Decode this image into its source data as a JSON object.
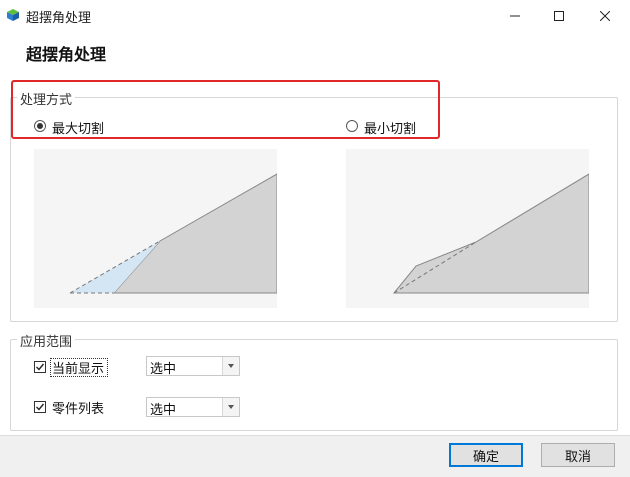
{
  "window": {
    "title": "超摆角处理",
    "icon": "app-cube-icon"
  },
  "header": {
    "title": "超摆角处理"
  },
  "processing_mode": {
    "group_label": "处理方式",
    "options": [
      {
        "label": "最大切割",
        "selected": true
      },
      {
        "label": "最小切割",
        "selected": false
      }
    ]
  },
  "apply_scope": {
    "group_label": "应用范围",
    "rows": [
      {
        "label": "当前显示",
        "checked": true,
        "combo_value": "选中"
      },
      {
        "label": "零件列表",
        "checked": true,
        "combo_value": "选中"
      }
    ]
  },
  "footer": {
    "ok_label": "确定",
    "cancel_label": "取消"
  },
  "colors": {
    "highlight": "#e0282b",
    "shape_fill": "#d3d3d3",
    "cut_fill": "#d4e6f4",
    "primary_border": "#0078d7"
  }
}
